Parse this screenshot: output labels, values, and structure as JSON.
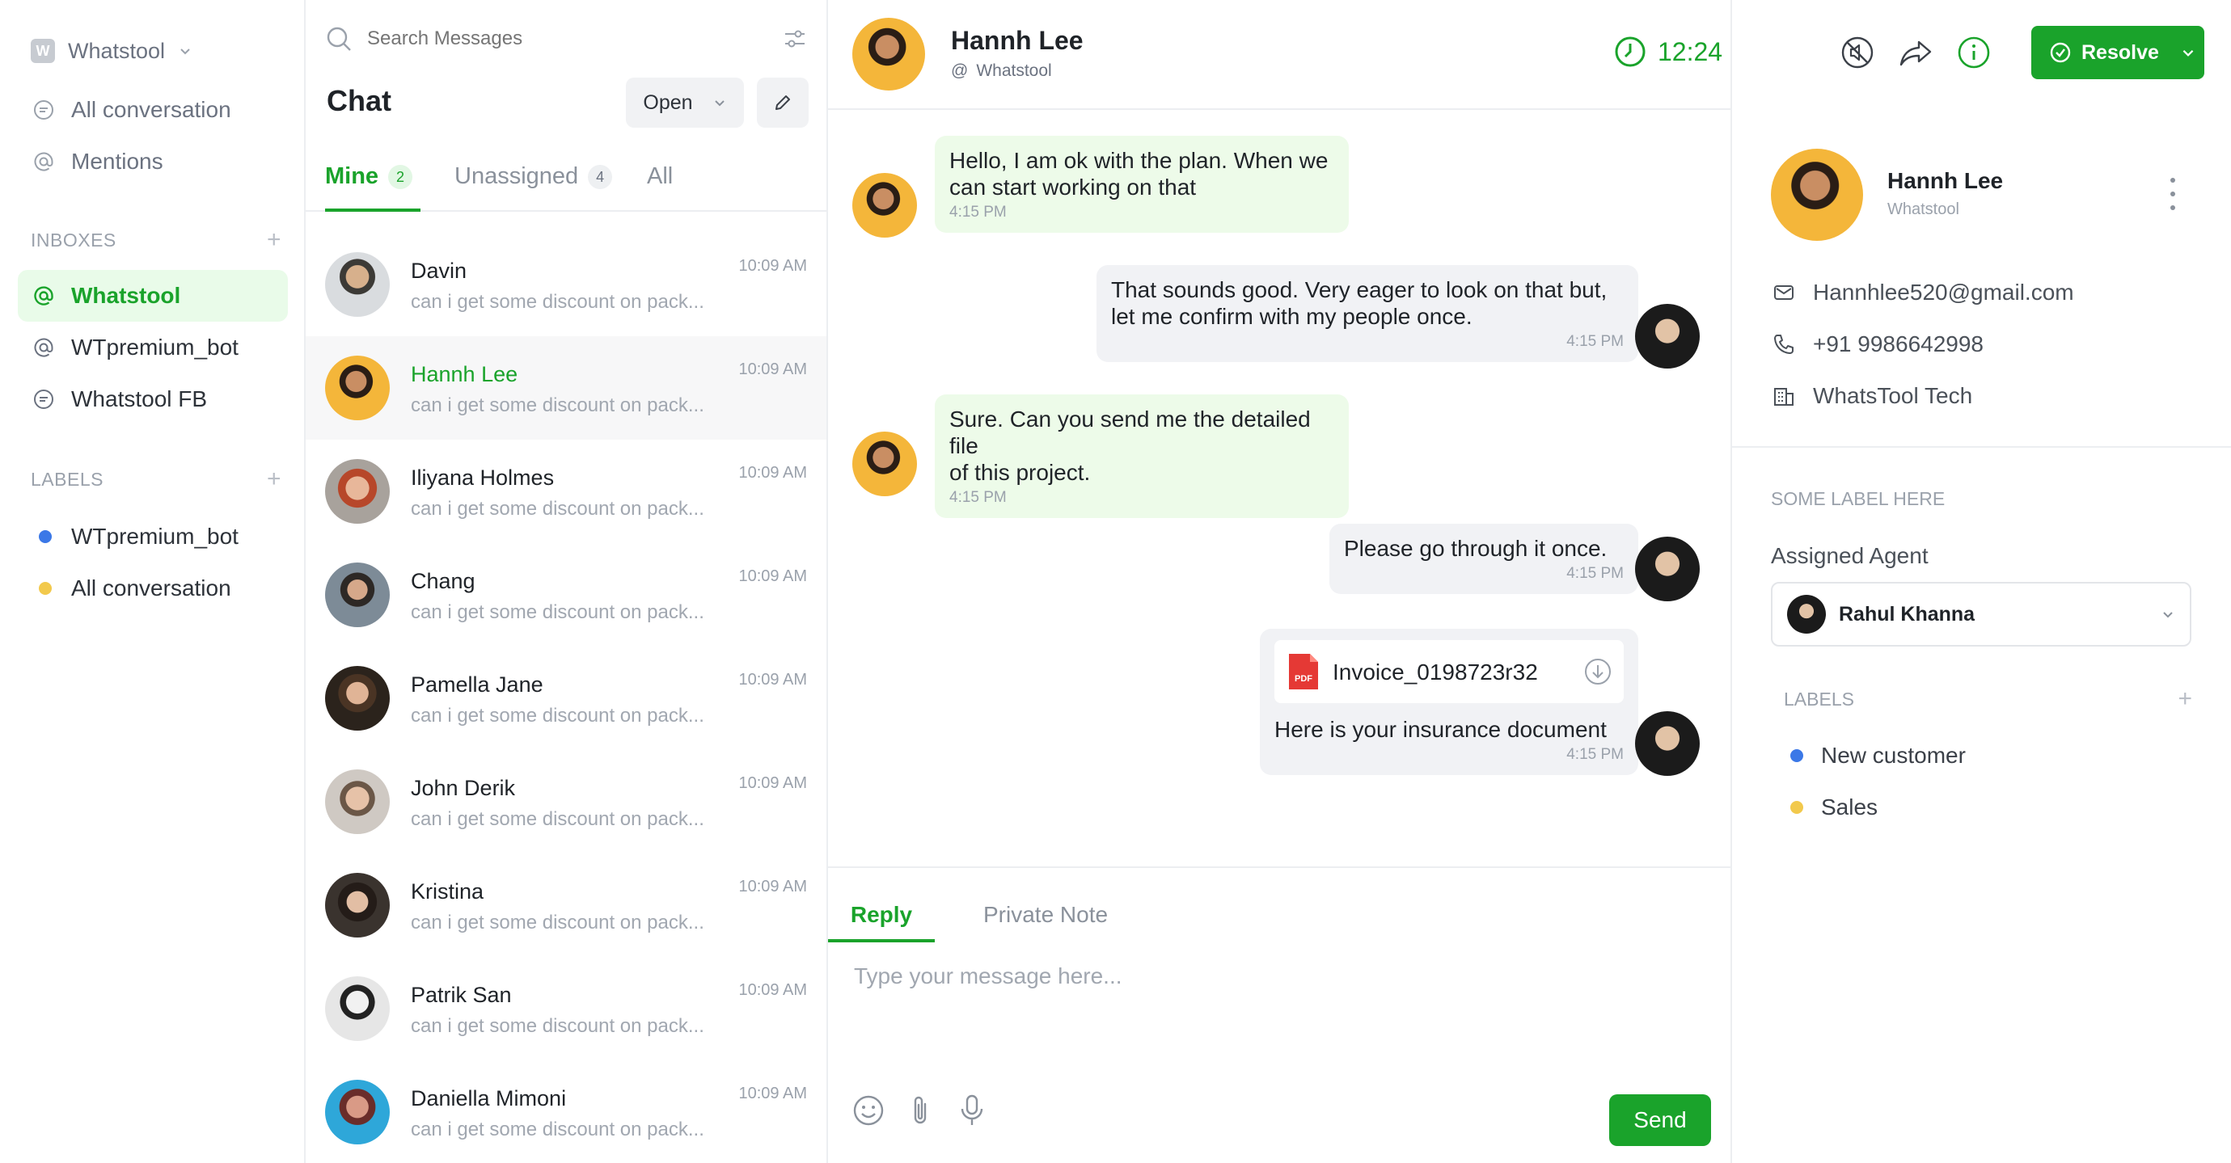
{
  "colors": {
    "accent": "#1aa32b",
    "label_blue": "#3b78e7",
    "label_yellow": "#f2c94c"
  },
  "nav": {
    "workspace_initial": "W",
    "workspace_name": "Whatstool",
    "items": [
      {
        "label": "All conversation",
        "icon": "chat-icon"
      },
      {
        "label": "Mentions",
        "icon": "at-icon"
      }
    ],
    "inboxes_heading": "INBOXES",
    "inboxes": [
      {
        "label": "Whatstool",
        "icon": "at-icon"
      },
      {
        "label": "WTpremium_bot",
        "icon": "at-icon"
      },
      {
        "label": "Whatstool FB",
        "icon": "chat-icon"
      }
    ],
    "labels_heading": "LABELS",
    "labels": [
      {
        "label": "WTpremium_bot",
        "color": "#3b78e7"
      },
      {
        "label": "All conversation",
        "color": "#f2c94c"
      }
    ]
  },
  "list": {
    "search_placeholder": "Search Messages",
    "title": "Chat",
    "status": "Open",
    "tabs": [
      {
        "label": "Mine",
        "count": "2"
      },
      {
        "label": "Unassigned",
        "count": "4"
      },
      {
        "label": "All",
        "count": ""
      }
    ],
    "conversations": [
      {
        "name": "Davin",
        "preview": "can i get some discount on pack...",
        "time": "10:09 AM"
      },
      {
        "name": "Hannh Lee",
        "preview": "can i get some discount on pack...",
        "time": "10:09 AM"
      },
      {
        "name": "Iliyana Holmes",
        "preview": "can i get some discount on pack...",
        "time": "10:09 AM"
      },
      {
        "name": "Chang",
        "preview": "can i get some discount on pack...",
        "time": "10:09 AM"
      },
      {
        "name": "Pamella Jane",
        "preview": "can i get some discount on pack...",
        "time": "10:09 AM"
      },
      {
        "name": "John Derik",
        "preview": "can i get some discount on pack...",
        "time": "10:09 AM"
      },
      {
        "name": "Kristina",
        "preview": "can i get some discount on pack...",
        "time": "10:09 AM"
      },
      {
        "name": "Patrik San",
        "preview": "can i get some discount on pack...",
        "time": "10:09 AM"
      },
      {
        "name": "Daniella Mimoni",
        "preview": "can i get some discount on pack...",
        "time": "10:09 AM"
      }
    ]
  },
  "conversation": {
    "contact_name": "Hannh Lee",
    "contact_inbox": "Whatstool",
    "timer": "12:24",
    "resolve_label": "Resolve",
    "messages": [
      {
        "text1": "Hello, I am ok with the plan. When we",
        "text2": "can start working on that",
        "time": "4:15 PM"
      },
      {
        "text1": "That sounds good. Very eager to look on that but,",
        "text2": "let me confirm with my people once.",
        "time": "4:15 PM"
      },
      {
        "text1": "Sure. Can you send me the detailed file",
        "text2": "of this project.",
        "time": "4:15 PM"
      },
      {
        "text1": "Please go through it once.",
        "time": "4:15 PM"
      },
      {
        "file_badge": "PDF",
        "file_name": "Invoice_0198723r32",
        "text1": "Here is your insurance document",
        "time": "4:15 PM"
      }
    ],
    "composer": {
      "tab_reply": "Reply",
      "tab_note": "Private Note",
      "placeholder": "Type your message here...",
      "send_label": "Send"
    }
  },
  "contact": {
    "name": "Hannh Lee",
    "inbox": "Whatstool",
    "email": "Hannhlee520@gmail.com",
    "phone": "+91 9986642998",
    "company": "WhatsTool Tech",
    "label_heading": "SOME LABEL HERE",
    "assigned_heading": "Assigned Agent",
    "agent": "Rahul Khanna",
    "labels_heading": "LABELS",
    "labels": [
      {
        "label": "New customer",
        "color": "#3b78e7"
      },
      {
        "label": "Sales",
        "color": "#f2c94c"
      }
    ]
  }
}
